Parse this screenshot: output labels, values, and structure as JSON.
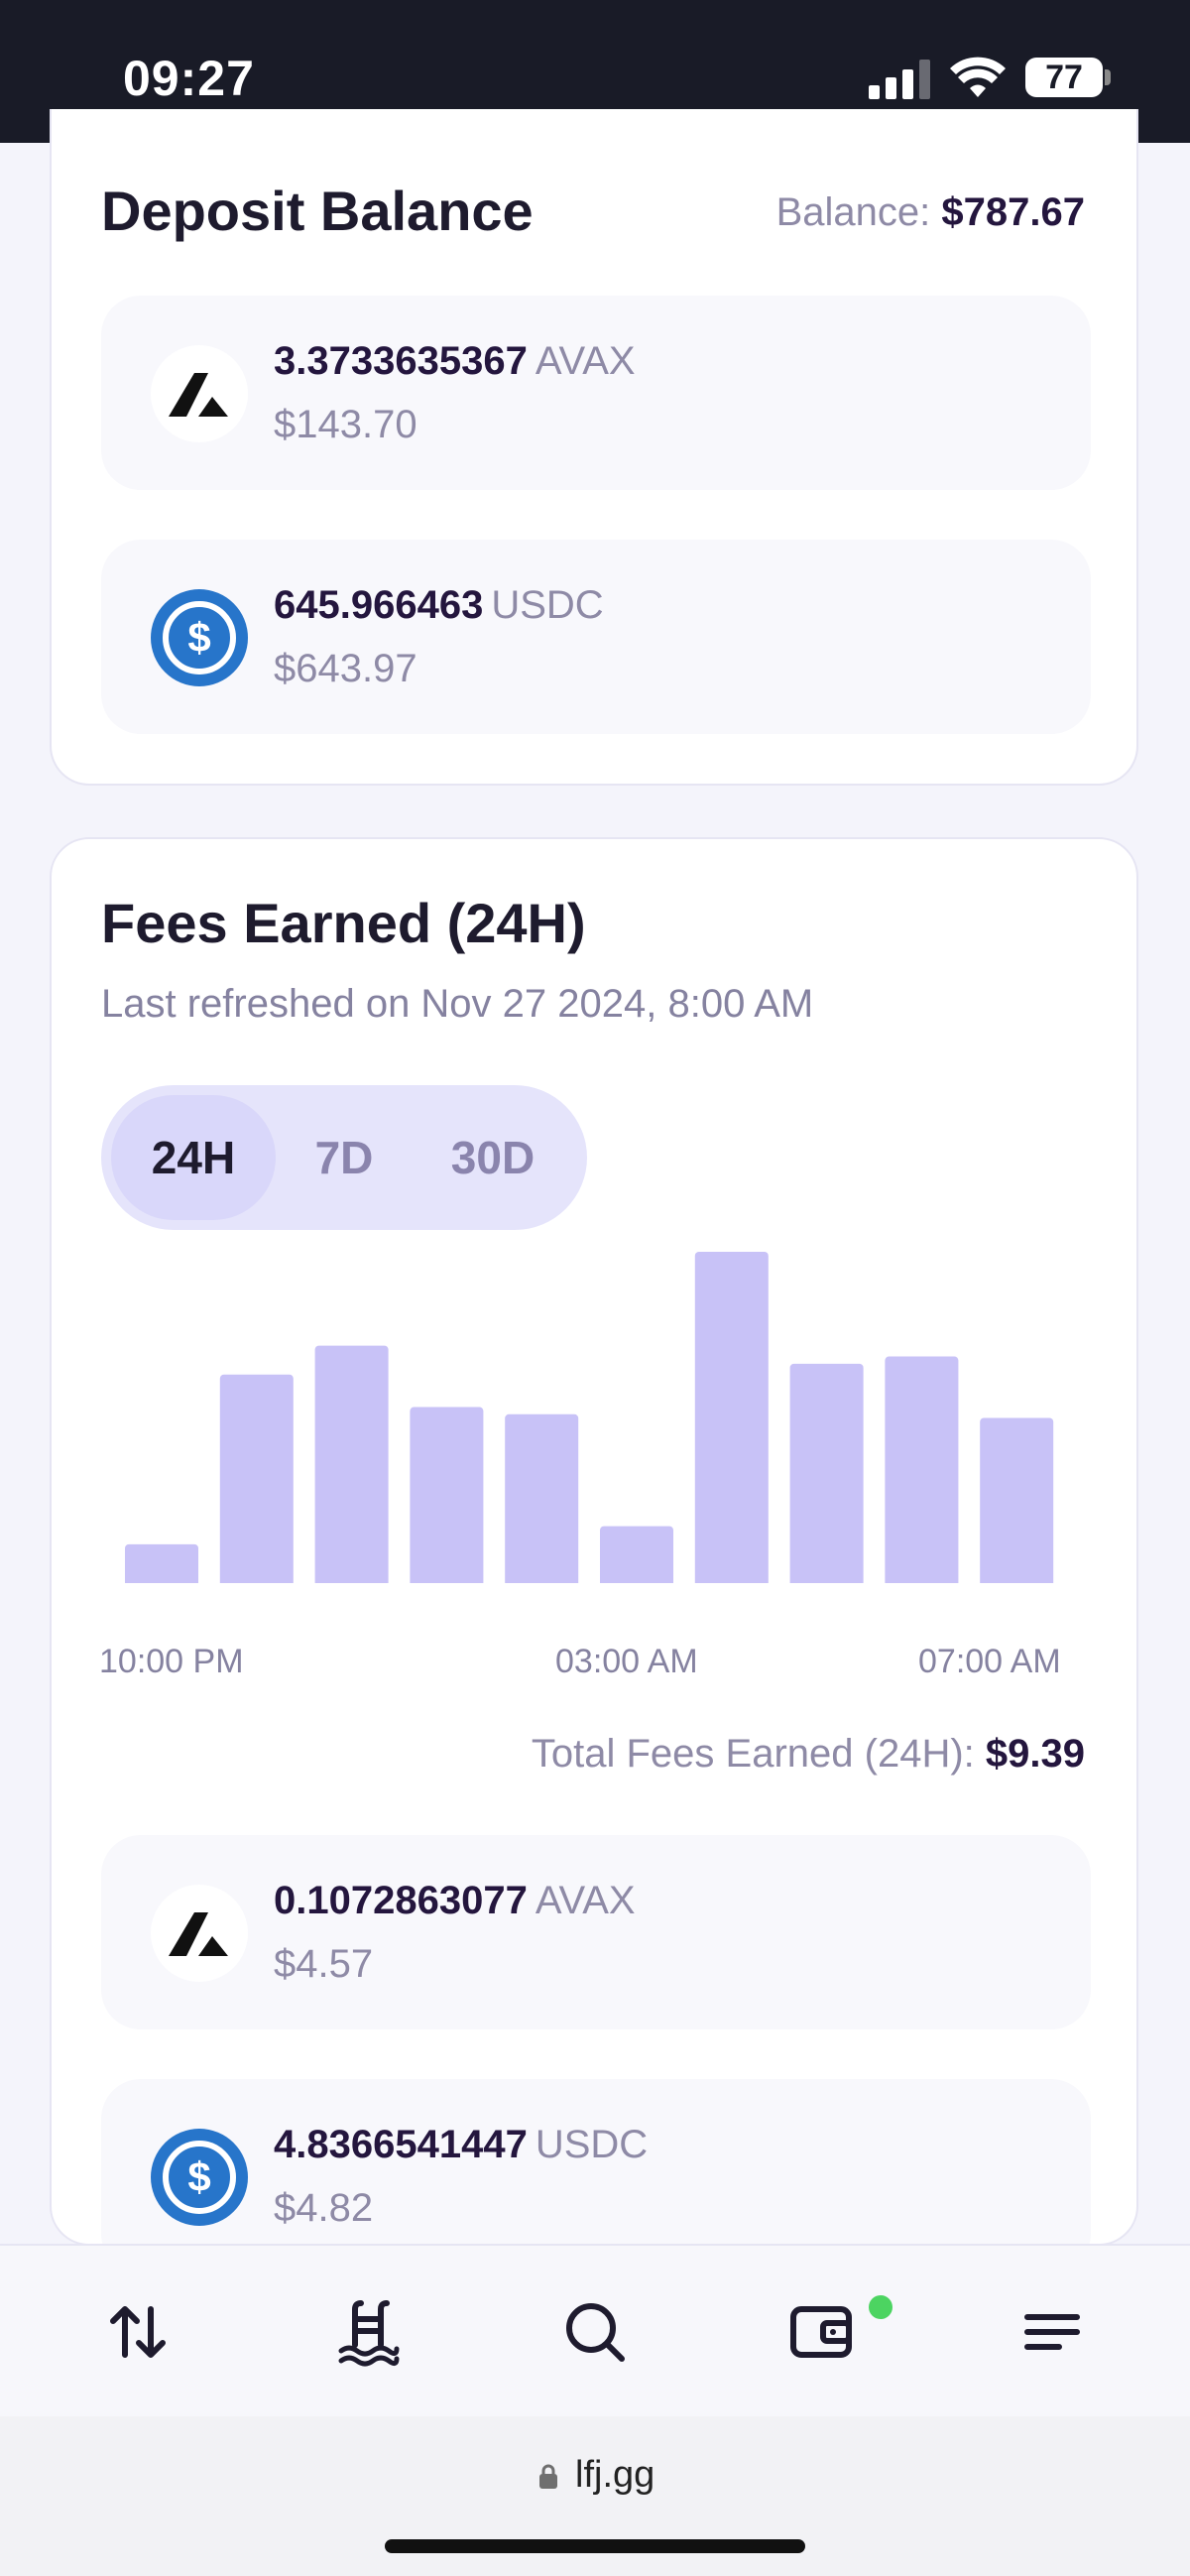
{
  "status_bar": {
    "time": "09:27",
    "battery": "77"
  },
  "deposit": {
    "title": "Deposit Balance",
    "balance_label": "Balance:",
    "balance_value": "$787.67",
    "tokens": [
      {
        "icon": "avax-icon",
        "amount": "3.3733635367",
        "symbol": "AVAX",
        "usd": "$143.70"
      },
      {
        "icon": "usdc-icon",
        "amount": "645.966463",
        "symbol": "USDC",
        "usd": "$643.97"
      }
    ]
  },
  "fees": {
    "title": "Fees Earned (24H)",
    "refreshed": "Last refreshed on Nov 27 2024, 8:00 AM",
    "tabs": [
      "24H",
      "7D",
      "30D"
    ],
    "active_tab": "24H",
    "total_label": "Total Fees Earned (24H):",
    "total_value": "$9.39",
    "tokens": [
      {
        "icon": "avax-icon",
        "amount": "0.1072863077",
        "symbol": "AVAX",
        "usd": "$4.57"
      },
      {
        "icon": "usdc-icon",
        "amount": "4.8366541447",
        "symbol": "USDC",
        "usd": "$4.82"
      }
    ]
  },
  "chart_data": {
    "type": "bar",
    "x_tick_labels": [
      "10:00 PM",
      "03:00 AM",
      "07:00 AM"
    ],
    "values": [
      0.19,
      0.66,
      0.74,
      0.57,
      0.55,
      0.24,
      1.0,
      0.69,
      0.71,
      0.54
    ],
    "bar_color": "#c8c2f7"
  },
  "bottom_nav": {
    "items": [
      "swap-icon",
      "pool-icon",
      "search-icon",
      "wallet-icon",
      "menu-icon"
    ],
    "notification_color": "#4cd461"
  },
  "browser": {
    "url": "lfj.gg"
  }
}
